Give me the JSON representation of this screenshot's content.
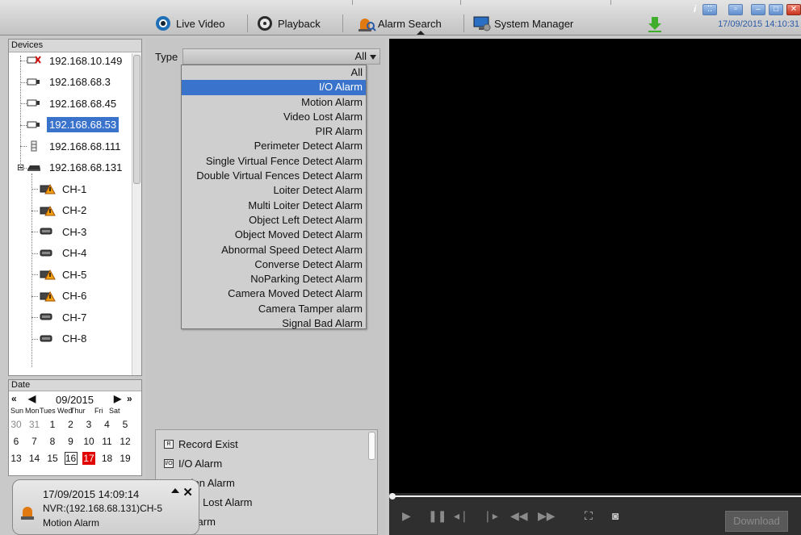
{
  "nav": {
    "live_video": "Live Video",
    "playback": "Playback",
    "alarm_search": "Alarm Search",
    "system_manager": "System Manager"
  },
  "window": {
    "info": "i",
    "clock": "17/09/2015 14:10:31"
  },
  "devices": {
    "header": "Devices",
    "items": [
      {
        "label": "192.168.10.149",
        "icon": "camera-offline-icon"
      },
      {
        "label": "192.168.68.3",
        "icon": "camera-icon"
      },
      {
        "label": "192.168.68.45",
        "icon": "camera-icon"
      },
      {
        "label": "192.168.68.53",
        "icon": "camera-icon",
        "selected": true
      },
      {
        "label": "192.168.68.111",
        "icon": "pir-sensor-icon"
      },
      {
        "label": "192.168.68.131",
        "icon": "nvr-icon",
        "expanded": true
      },
      {
        "label": "CH-1",
        "icon": "channel-alarm-icon"
      },
      {
        "label": "CH-2",
        "icon": "channel-alarm-icon"
      },
      {
        "label": "CH-3",
        "icon": "channel-icon"
      },
      {
        "label": "CH-4",
        "icon": "channel-icon"
      },
      {
        "label": "CH-5",
        "icon": "channel-alarm-icon"
      },
      {
        "label": "CH-6",
        "icon": "channel-alarm-icon"
      },
      {
        "label": "CH-7",
        "icon": "channel-icon"
      },
      {
        "label": "CH-8",
        "icon": "channel-icon"
      }
    ]
  },
  "date": {
    "header": "Date",
    "month": "09/2015",
    "weekdays": [
      "Sun",
      "Mon",
      "Tues",
      "Wed",
      "Thur",
      "Fri",
      "Sat"
    ],
    "rows": [
      [
        "30",
        "31",
        "1",
        "2",
        "3",
        "4",
        "5"
      ],
      [
        "6",
        "7",
        "8",
        "9",
        "10",
        "11",
        "12"
      ],
      [
        "13",
        "14",
        "15",
        "16",
        "17",
        "18",
        "19"
      ]
    ],
    "today": "16",
    "highlight": "17"
  },
  "search": {
    "type_label": "Type",
    "type_value": "All",
    "options": [
      "All",
      "I/O Alarm",
      "Motion Alarm",
      "Video Lost Alarm",
      "PIR Alarm",
      "Perimeter Detect Alarm",
      "Single Virtual Fence Detect Alarm",
      "Double Virtual Fences Detect Alarm",
      "Loiter Detect Alarm",
      "Multi Loiter Detect Alarm",
      "Object Left Detect Alarm",
      "Object Moved Detect Alarm",
      "Abnormal Speed Detect Alarm",
      "Converse Detect Alarm",
      "NoParking Detect Alarm",
      "Camera Moved Detect Alarm",
      "Camera Tamper alarm",
      "Signal Bad Alarm"
    ],
    "active_option": "I/O Alarm"
  },
  "legend": {
    "items": [
      {
        "icon_text": "R",
        "label": "Record Exist"
      },
      {
        "icon_text": "I/O",
        "label": "I/O Alarm"
      },
      {
        "icon_text": "",
        "label": "tion Alarm"
      },
      {
        "icon_text": "",
        "label": "eo Lost Alarm"
      },
      {
        "icon_text": "",
        "label": "Alarm"
      }
    ]
  },
  "player": {
    "download": "Download"
  },
  "popup": {
    "time": "17/09/2015 14:09:14",
    "source": "NVR:(192.168.68.131)CH-5",
    "type": "Motion Alarm"
  },
  "colors": {
    "selection": "#3a73cc",
    "highlight_day": "#e00000",
    "accent_clock": "#2a5aa5"
  }
}
